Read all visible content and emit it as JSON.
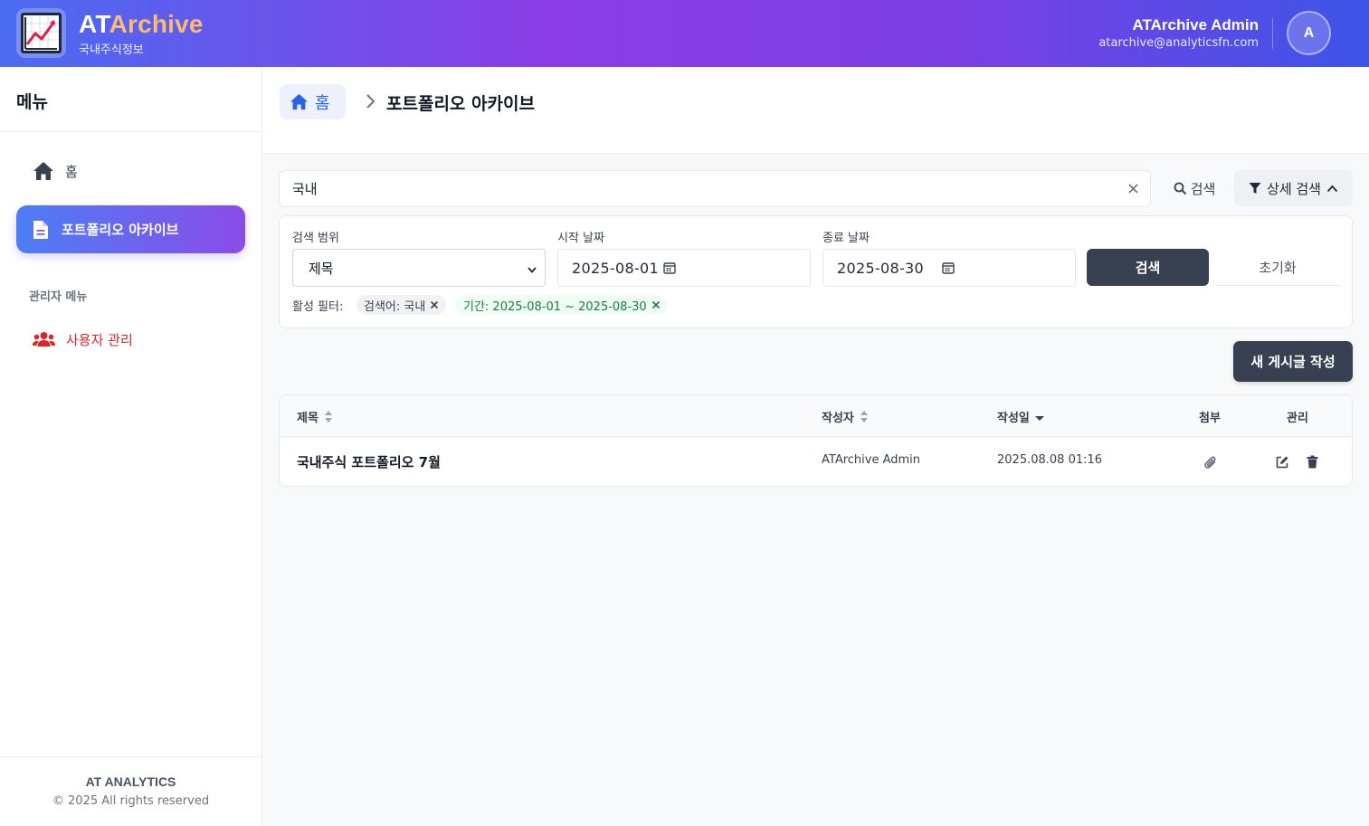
{
  "header": {
    "brand_prefix": "AT",
    "brand_accent": "Archive",
    "subtitle": "국내주식정보",
    "user_name": "ATArchive Admin",
    "user_email": "atarchive@analyticsfn.com",
    "avatar_initial": "A"
  },
  "sidebar": {
    "title": "메뉴",
    "items": [
      {
        "label": "홈",
        "icon": "home-icon",
        "active": false
      },
      {
        "label": "포트폴리오 아카이브",
        "icon": "document-icon",
        "active": true
      }
    ],
    "admin_section": "관리자 메뉴",
    "admin_items": [
      {
        "label": "사용자 관리",
        "icon": "users-icon"
      }
    ],
    "footer_company": "AT ANALYTICS",
    "footer_copy": "© 2025 All rights reserved"
  },
  "breadcrumb": {
    "home_label": "홈",
    "current": "포트폴리오 아카이브"
  },
  "search": {
    "value": "국내",
    "button_label": "검색",
    "advanced_label": "상세 검색"
  },
  "filters": {
    "scope_label": "검색 범위",
    "scope_value": "제목",
    "start_label": "시작 날짜",
    "start_value": "2025-08-01",
    "end_label": "종료 날짜",
    "end_value": "2025-08-30",
    "search_button": "검색",
    "reset_button": "초기화",
    "active_label": "활성 필터:",
    "chips": [
      "검색어: 국내",
      "기간: 2025-08-01 ~ 2025-08-30"
    ]
  },
  "actions": {
    "new_post": "새 게시글 작성"
  },
  "table": {
    "columns": [
      "제목",
      "작성자",
      "작성일",
      "첨부",
      "관리"
    ],
    "rows": [
      {
        "title": "국내주식 포트폴리오 7월",
        "author": "ATArchive Admin",
        "date": "2025.08.08 01:16"
      }
    ]
  },
  "colors": {
    "accent_blue": "#2563eb",
    "active_gradient_start": "#4d7ef5",
    "active_gradient_end": "#8a4ce8",
    "admin_red": "#dc2626",
    "button_dark": "#374151",
    "chip_green": "#15803d"
  }
}
